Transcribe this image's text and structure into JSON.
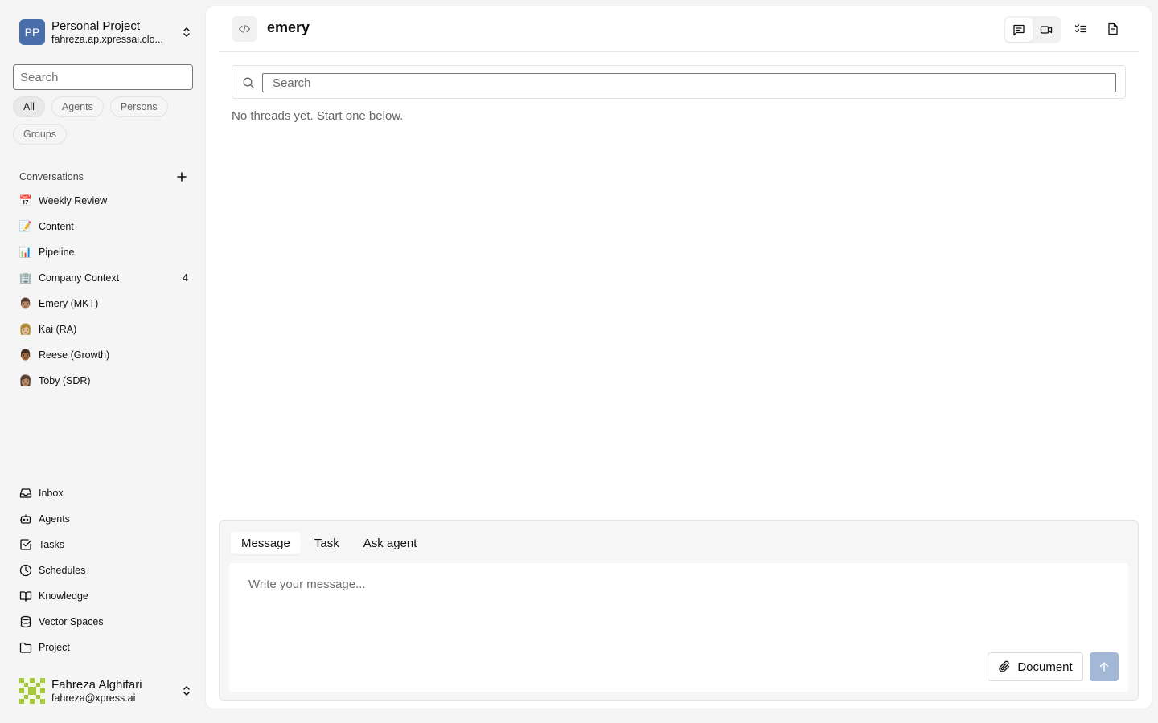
{
  "project": {
    "initials": "PP",
    "name": "Personal Project",
    "url": "fahreza.ap.xpressai.clo..."
  },
  "sidebar_search": {
    "placeholder": "Search"
  },
  "filters": [
    "All",
    "Agents",
    "Persons",
    "Groups"
  ],
  "conversations": {
    "title": "Conversations",
    "items": [
      {
        "emoji": "📅",
        "label": "Weekly Review",
        "count": ""
      },
      {
        "emoji": "📝",
        "label": "Content",
        "count": ""
      },
      {
        "emoji": "📊",
        "label": "Pipeline",
        "count": ""
      },
      {
        "emoji": "🏢",
        "label": "Company Context",
        "count": "4"
      },
      {
        "emoji": "👨🏽",
        "label": "Emery (MKT)",
        "count": ""
      },
      {
        "emoji": "👩🏼",
        "label": "Kai (RA)",
        "count": ""
      },
      {
        "emoji": "👨🏾",
        "label": "Reese (Growth)",
        "count": ""
      },
      {
        "emoji": "👩🏽",
        "label": "Toby (SDR)",
        "count": ""
      }
    ]
  },
  "nav": [
    {
      "icon": "inbox-icon",
      "label": "Inbox"
    },
    {
      "icon": "bot-icon",
      "label": "Agents"
    },
    {
      "icon": "check-square-icon",
      "label": "Tasks"
    },
    {
      "icon": "clock-icon",
      "label": "Schedules"
    },
    {
      "icon": "book-icon",
      "label": "Knowledge"
    },
    {
      "icon": "database-icon",
      "label": "Vector Spaces"
    },
    {
      "icon": "folder-icon",
      "label": "Project"
    }
  ],
  "user": {
    "name": "Fahreza Alghifari",
    "email": "fahreza@xpress.ai"
  },
  "header": {
    "title": "emery"
  },
  "thread_search": {
    "placeholder": "Search"
  },
  "empty_state": "No threads yet. Start one below.",
  "composer": {
    "tabs": [
      "Message",
      "Task",
      "Ask agent"
    ],
    "active_tab": "Message",
    "placeholder": "Write your message...",
    "document_label": "Document"
  },
  "colors": {
    "accent": "#4a6ea9",
    "send_disabled": "#a3b8d7"
  }
}
